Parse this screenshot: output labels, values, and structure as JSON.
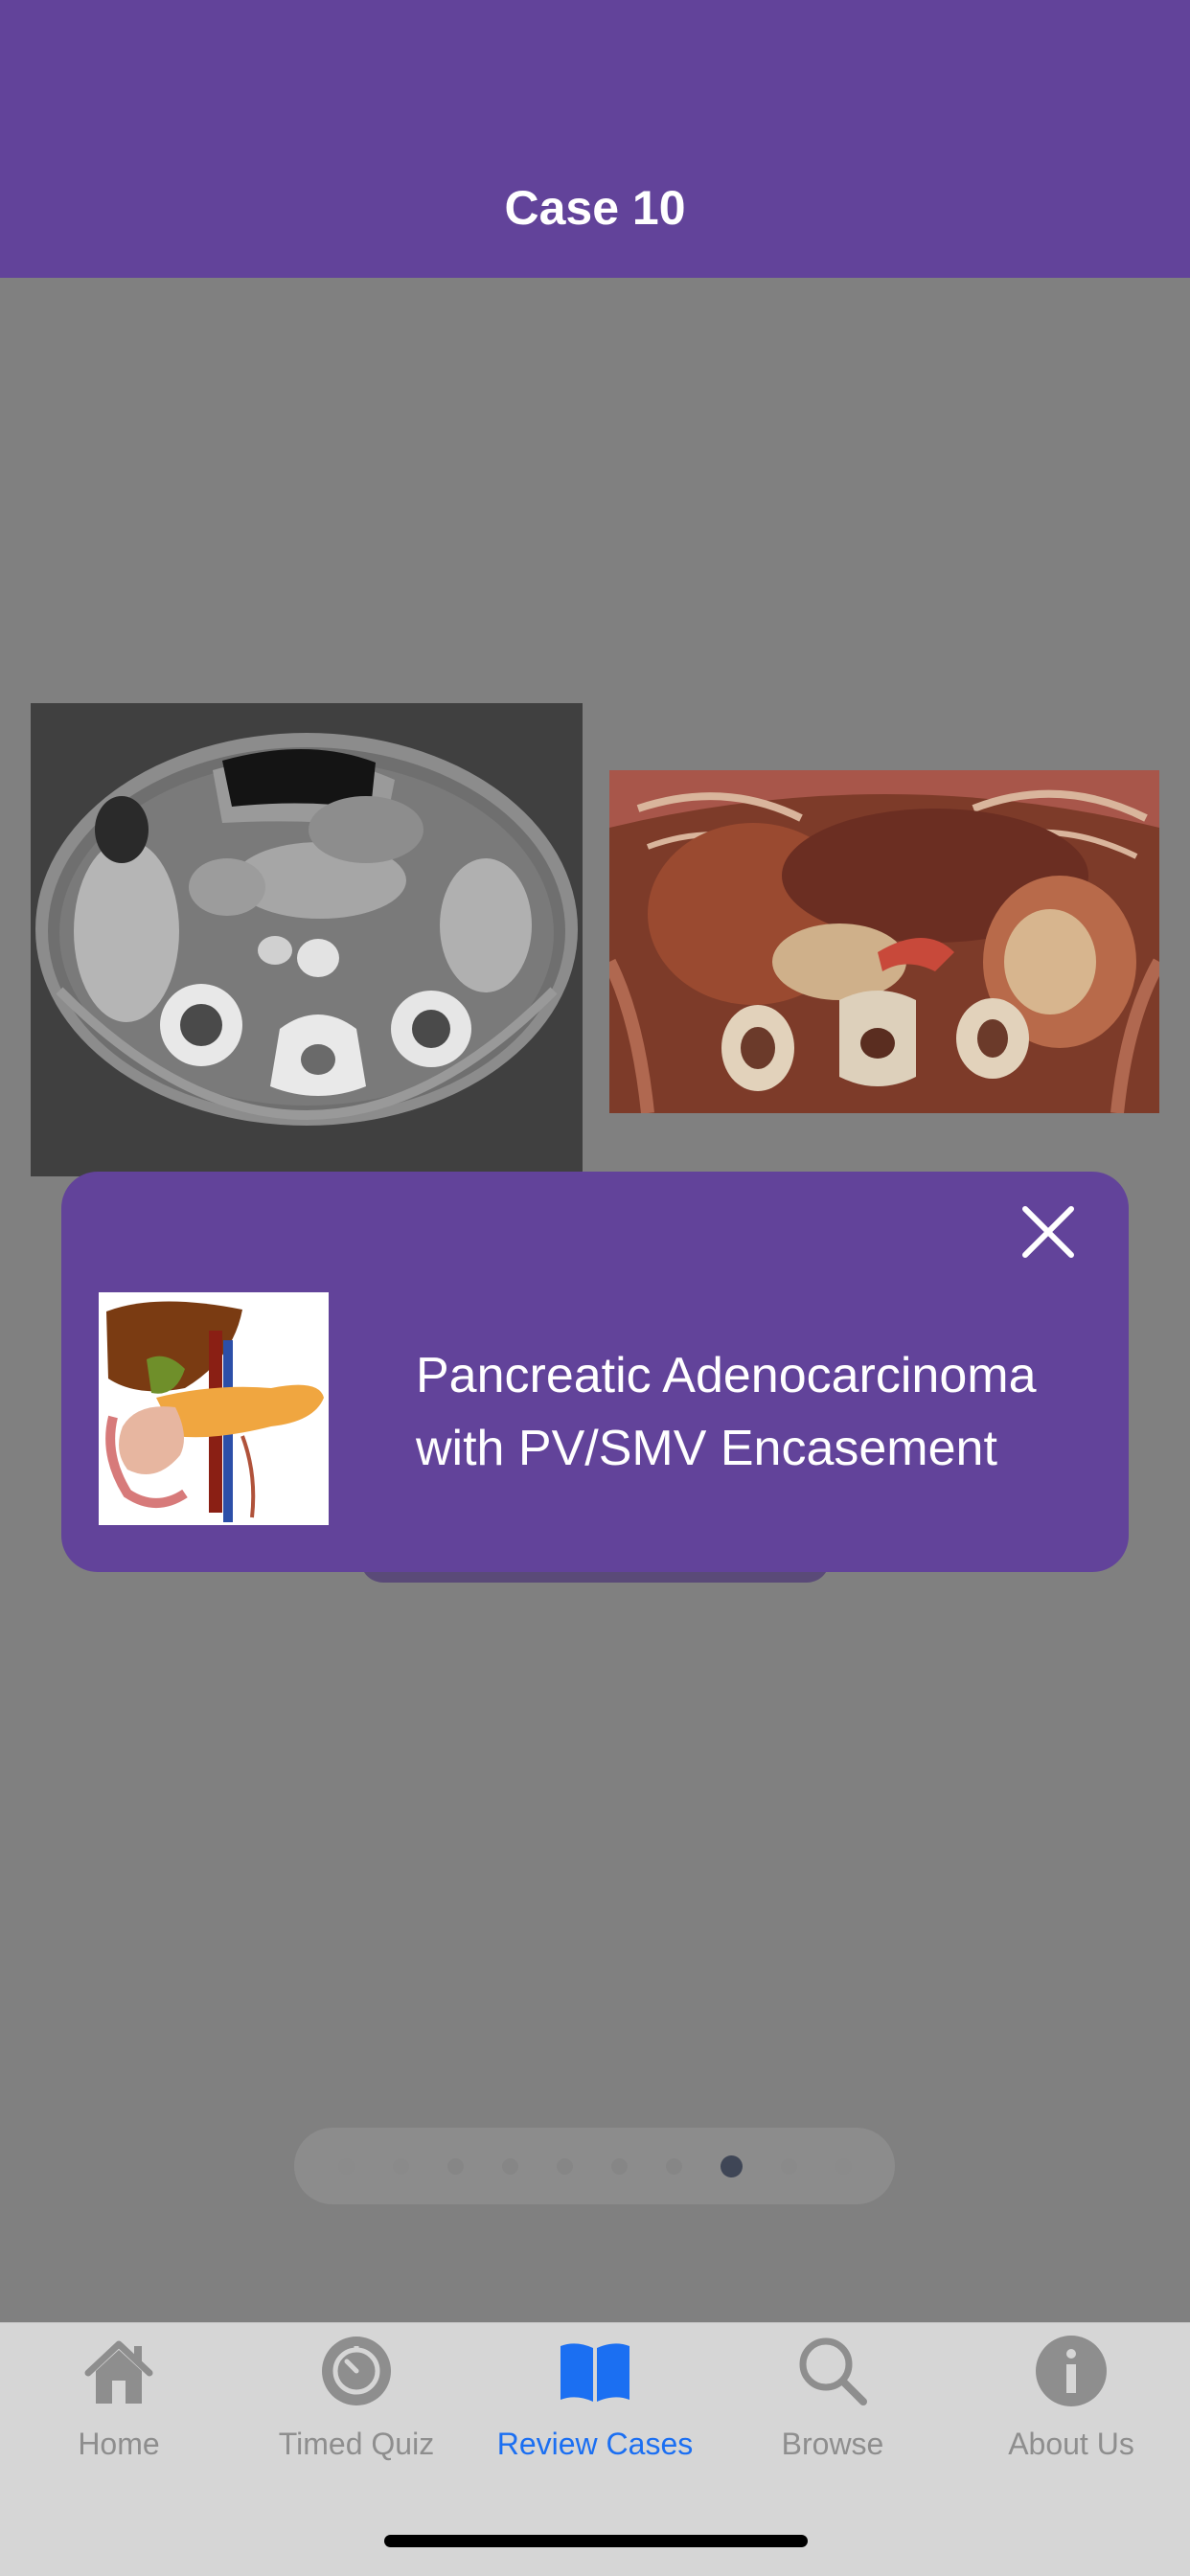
{
  "header": {
    "title": "Case 10"
  },
  "images": [
    {
      "name": "axial-ct-image",
      "alt": "Axial contrast-enhanced CT of the abdomen"
    },
    {
      "name": "3d-reconstruction-image",
      "alt": "3D volume-rendered CT reconstruction"
    }
  ],
  "diagnosis": {
    "line1": "Pancreatic Adenocarcinoma",
    "line2": "with PV/SMV Encasement",
    "close_icon": "close-icon",
    "thumbnail_icon": "pancreas-anatomy-illustration"
  },
  "pager": {
    "total": 10,
    "current": 8
  },
  "tabbar": {
    "items": [
      {
        "label": "Home",
        "icon": "home-icon",
        "active": false
      },
      {
        "label": "Timed Quiz",
        "icon": "timer-icon",
        "active": false
      },
      {
        "label": "Review Cases",
        "icon": "book-icon",
        "active": true
      },
      {
        "label": "Browse",
        "icon": "search-icon",
        "active": false
      },
      {
        "label": "About Us",
        "icon": "info-icon",
        "active": false
      }
    ]
  },
  "colors": {
    "header": "#62439a",
    "card": "#62439a",
    "active_tab": "#1b6ff2",
    "inactive_tab": "#8e8e8e",
    "overlay_background": "#808080"
  }
}
